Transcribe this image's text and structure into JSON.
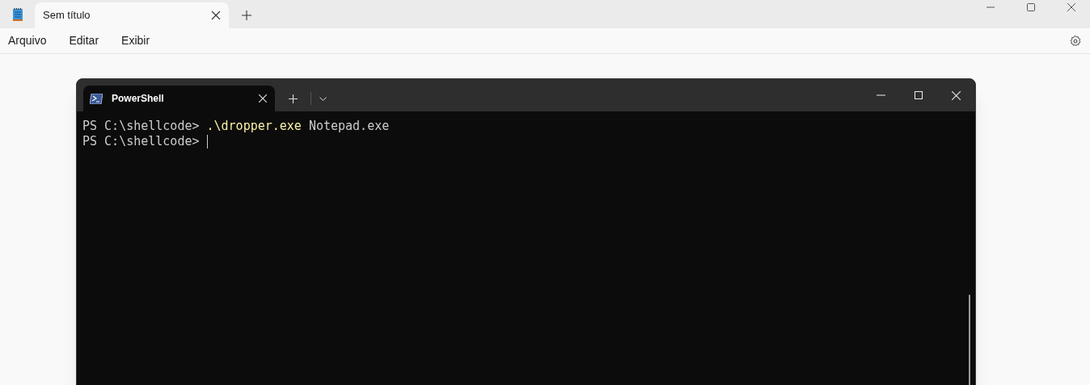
{
  "notepad": {
    "tab": {
      "title": "Sem título"
    },
    "menu": [
      "Arquivo",
      "Editar",
      "Exibir"
    ]
  },
  "terminal": {
    "tab": {
      "title": "PowerShell"
    },
    "lines": [
      {
        "prompt": "PS C:\\shellcode>",
        "command": ".\\dropper.exe",
        "args": "Notepad.exe",
        "cursor": false
      },
      {
        "prompt": "PS C:\\shellcode>",
        "cursor": true
      }
    ]
  }
}
